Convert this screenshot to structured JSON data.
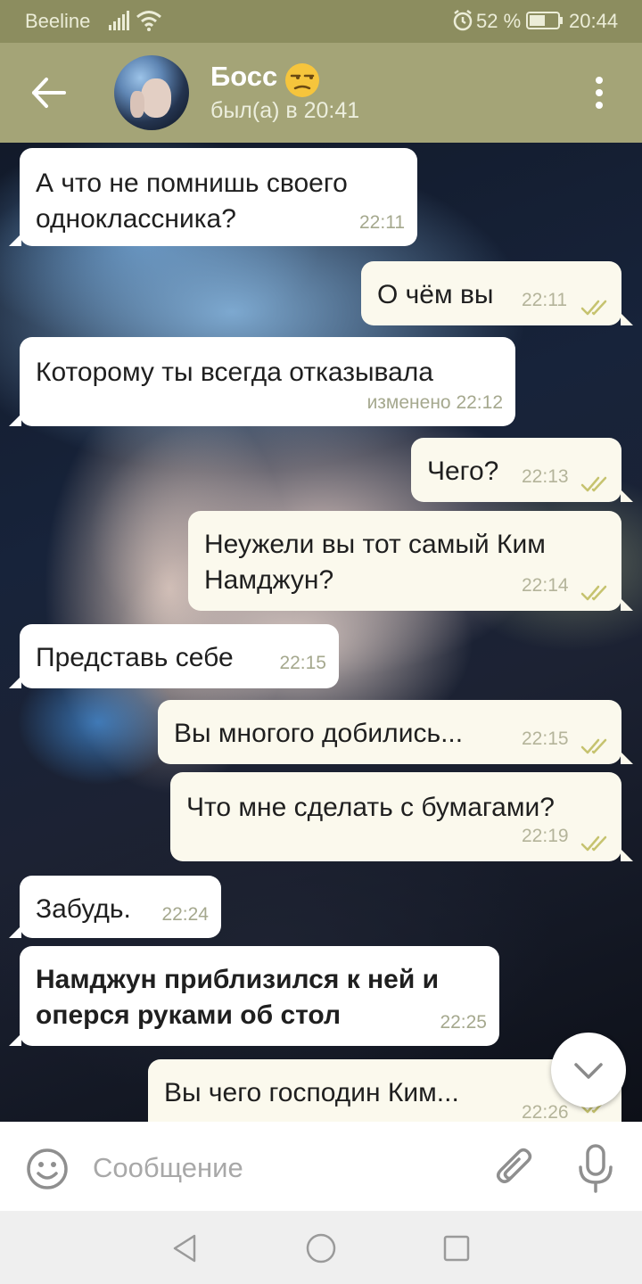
{
  "status_bar": {
    "carrier": "Beeline",
    "battery": "52 %",
    "time": "20:44"
  },
  "header": {
    "name": "Босс",
    "status": "был(а) в 20:41"
  },
  "messages": [
    {
      "direction": "in",
      "text": "А что не помнишь своего\nодноклассника?",
      "time": "22:11",
      "bold": false
    },
    {
      "direction": "out",
      "text": "О чём вы",
      "time": "22:11",
      "read": true
    },
    {
      "direction": "in",
      "text": "Которому ты всегда отказывала",
      "time": "изменено 22:12",
      "bold": false
    },
    {
      "direction": "out",
      "text": "Чего?",
      "time": "22:13",
      "read": true
    },
    {
      "direction": "out",
      "text": "Неужели вы тот самый Ким\nНамджун?",
      "time": "22:14",
      "read": true
    },
    {
      "direction": "in",
      "text": "Представь себе",
      "time": "22:15",
      "bold": false
    },
    {
      "direction": "out",
      "text": "Вы многого добились...",
      "time": "22:15",
      "read": true
    },
    {
      "direction": "out",
      "text": "Что мне сделать с бумагами?",
      "time": "22:19",
      "read": true
    },
    {
      "direction": "in",
      "text": "Забудь.",
      "time": "22:24",
      "bold": false
    },
    {
      "direction": "in",
      "text": "Намджун приблизился к ней и\nоперся руками об стол",
      "time": "22:25",
      "bold": true
    },
    {
      "direction": "out",
      "text": "Вы чего господин Ким...",
      "time": "22:26",
      "read": true
    }
  ],
  "input": {
    "placeholder": "Сообщение"
  },
  "colors": {
    "header": "#a4a477",
    "status_bar": "#8c8d5f",
    "outgoing_bubble": "#fbf9ed",
    "incoming_bubble": "#ffffff",
    "read_check": "#c6c36f"
  },
  "icons": [
    "back-arrow-icon",
    "avatar",
    "unamused-face-emoji",
    "more-vert-icon",
    "chevron-down-icon",
    "smiley-icon",
    "paperclip-icon",
    "microphone-icon",
    "nav-back-icon",
    "nav-home-icon",
    "nav-recent-icon"
  ]
}
